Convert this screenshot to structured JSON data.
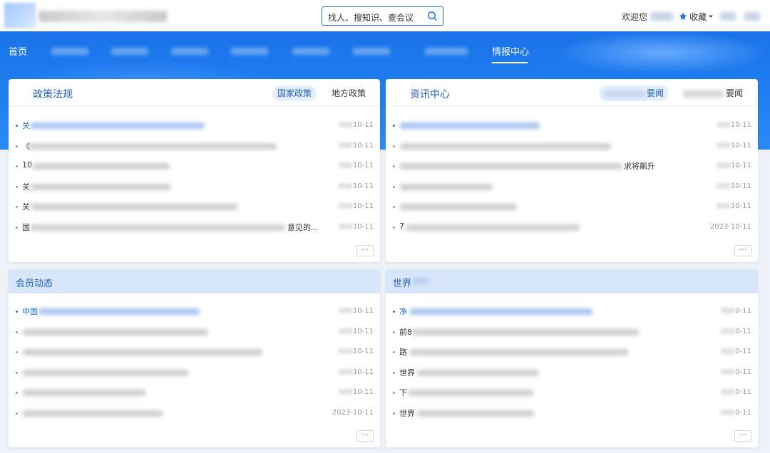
{
  "header": {
    "search_placeholder": "找人、搜知识、查会议",
    "welcome": "欢迎您",
    "favorites": "收藏"
  },
  "nav": {
    "home": "首页",
    "intel_center": "情报中心"
  },
  "panels": {
    "policy": {
      "title": "政策法规",
      "tabs": [
        "国家政策",
        "地方政策"
      ],
      "rows": [
        {
          "text": "关",
          "date": "10-11"
        },
        {
          "text": "《",
          "date": "10-11"
        },
        {
          "text": "10",
          "date": "10-11"
        },
        {
          "text": "关",
          "date": "10-11"
        },
        {
          "text": "关",
          "date": "10-11"
        },
        {
          "text": "国",
          "suffix": "意见的...",
          "date": "10-11"
        }
      ],
      "more": "···"
    },
    "news": {
      "title": "资讯中心",
      "tabs": [
        "要闻",
        "要闻"
      ],
      "rows": [
        {
          "text": "",
          "date": "10-11"
        },
        {
          "text": "",
          "date": "10-11"
        },
        {
          "text": "",
          "suffix": "求将飙升",
          "date": "10-11"
        },
        {
          "text": "",
          "date": "10-11"
        },
        {
          "text": "",
          "date": "10-11"
        },
        {
          "text": "7",
          "date": "2023-10-11"
        }
      ],
      "more": "···"
    },
    "members": {
      "title": "会员动态",
      "rows": [
        {
          "text": "中国",
          "date": "10-11"
        },
        {
          "text": "",
          "date": "10-11"
        },
        {
          "text": "",
          "date": "10-11"
        },
        {
          "text": "",
          "date": "10-11"
        },
        {
          "text": "",
          "date": "10-11"
        },
        {
          "text": "",
          "date": "2023-10-11"
        }
      ],
      "more": "···"
    },
    "world": {
      "title": "世界",
      "rows": [
        {
          "text": "净",
          "date": "0-11"
        },
        {
          "text": "前8",
          "date": "0-11"
        },
        {
          "text": "路",
          "date": "0-11"
        },
        {
          "text": "世界",
          "date": "0-11"
        },
        {
          "text": "下",
          "date": "0-11"
        },
        {
          "text": "世界",
          "date": "0-11"
        }
      ],
      "more": "···"
    }
  }
}
